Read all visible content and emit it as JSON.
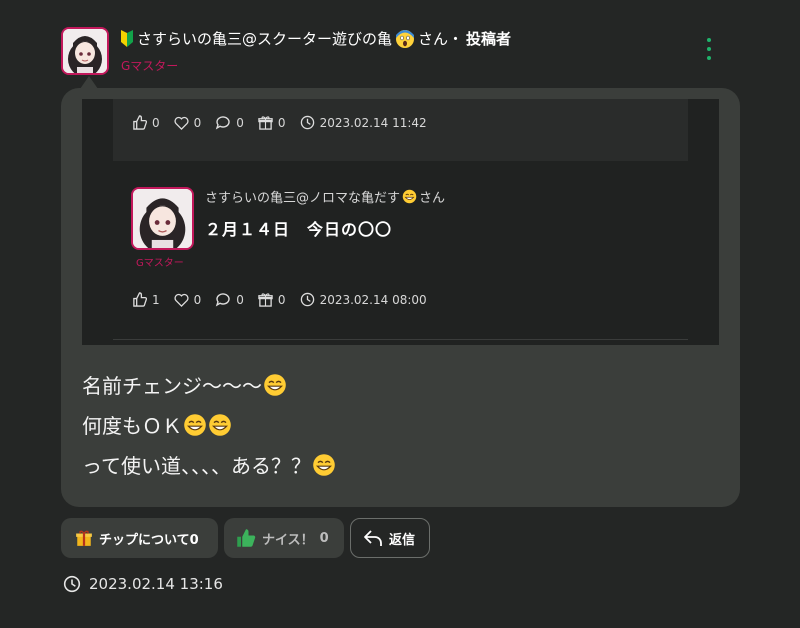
{
  "post": {
    "author_name": "さすらいの亀三@スクーター遊びの亀",
    "author_suffix": "さん・",
    "author_role": "投稿者",
    "rank": "Gマスター",
    "body_lines": [
      "名前チェンジ〜〜〜",
      "何度もＯＫ",
      "って使い道、、、、ある？？"
    ],
    "timestamp": "2023.02.14 13:16"
  },
  "quote_top": {
    "thumbs": "0",
    "hearts": "0",
    "comments": "0",
    "gifts": "0",
    "timestamp": "2023.02.14 11:42"
  },
  "reply": {
    "author_name": "さすらいの亀三@ノロマな亀だす",
    "author_suffix": "さん",
    "rank": "Gマスター",
    "text": "２月１４日　今日の〇〇",
    "thumbs": "1",
    "hearts": "0",
    "comments": "0",
    "gifts": "0",
    "timestamp": "2023.02.14 08:00"
  },
  "actions": {
    "tip_label": "チップについて",
    "tip_count": "0",
    "nice_label": "ナイス！",
    "nice_count": "0",
    "reply_label": "返信"
  },
  "icons": [
    "beginner-mark-icon",
    "scream-emoji-icon",
    "grin-emoji-icon",
    "kebab-menu-icon",
    "thumbs-up-icon",
    "heart-icon",
    "comment-icon",
    "gift-icon",
    "clock-icon",
    "reply-arrow-icon"
  ],
  "colors": {
    "accent": "#c2185b",
    "menu": "#1fb36b",
    "bubble": "#3b3e3b",
    "background": "#242625"
  }
}
